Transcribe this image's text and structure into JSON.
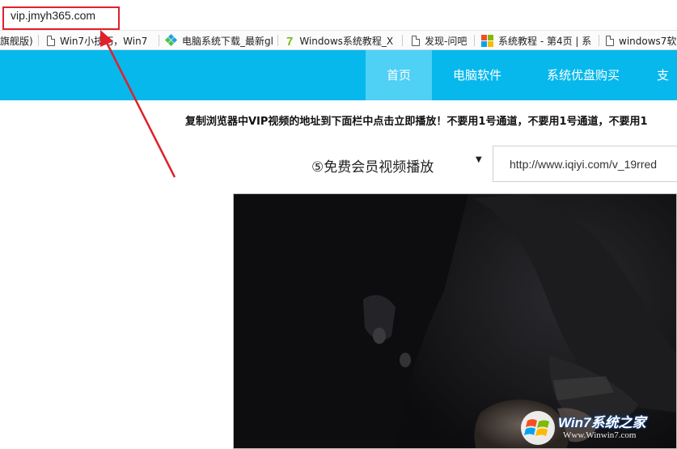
{
  "browser": {
    "address": "vip.jmyh365.com"
  },
  "bookmarks": [
    {
      "label": "旗舰版)",
      "icon": "none"
    },
    {
      "label": "Win7小技巧，Win7",
      "icon": "document-icon"
    },
    {
      "label": "电脑系统下载_最新gl",
      "icon": "diamond-icon"
    },
    {
      "label": "Windows系统教程_X",
      "icon": "seven-icon"
    },
    {
      "label": "发现-问吧",
      "icon": "document-icon"
    },
    {
      "label": "系统教程 - 第4页 | 系",
      "icon": "windows-logo-icon"
    },
    {
      "label": "windows7软",
      "icon": "document-icon"
    }
  ],
  "nav": {
    "items": [
      "首页",
      "电脑软件",
      "系统优盘购买",
      "支"
    ],
    "active_index": 0
  },
  "colors": {
    "nav_bg": "#06b8ec",
    "nav_active": "#4fd0f5",
    "highlight_red": "#e0202a",
    "video_bg": "#101012"
  },
  "main": {
    "notice": "复制浏览器中VIP视频的地址到下面栏中点击立即播放！不要用1号通道，不要用1号通道，不要用1",
    "channel_label": "⑤免费会员视频播放",
    "url_value": "http://www.iqiyi.com/v_19rred"
  },
  "watermark": {
    "title": "Win7系统之家",
    "subtitle": "Www.Winwin7.com"
  }
}
